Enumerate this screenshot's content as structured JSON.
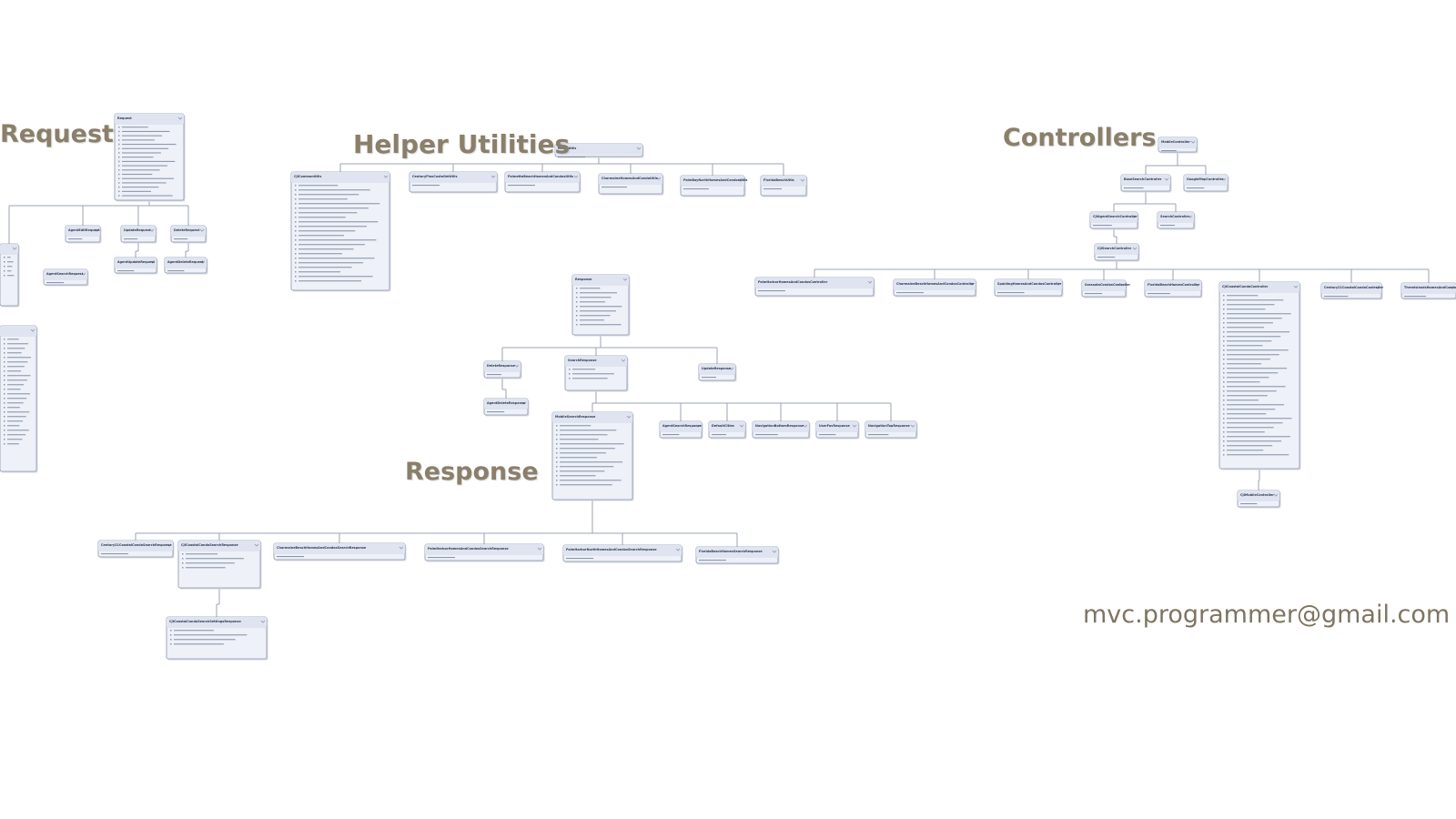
{
  "sections": {
    "request": "Request",
    "helper": "Helper Utilities",
    "controllers": "Controllers",
    "response": "Response"
  },
  "contact": {
    "email": "mvc.programmer@gmail.com"
  },
  "colors": {
    "box_fill": "#eef1f8",
    "box_header": "#dfe4f0",
    "box_border": "#8c96ad",
    "connector": "#9aa3b5",
    "title_text": "#8a7f6a",
    "member_text": "#8d97ab"
  },
  "classes": [
    {
      "id": "request",
      "name": "Request",
      "members": 17
    },
    {
      "id": "agent-edit-request",
      "name": "AgentEditRequest",
      "members": 0
    },
    {
      "id": "update-request",
      "name": "UpdateRequest",
      "members": 0
    },
    {
      "id": "delete-request",
      "name": "DeleteRequest",
      "members": 0
    },
    {
      "id": "agent-update-request",
      "name": "AgentUpdateRequest",
      "members": 0
    },
    {
      "id": "agent-delete-request",
      "name": "AgentDeleteRequest",
      "members": 0
    },
    {
      "id": "agent-search-request",
      "name": "AgentSearchRequest",
      "members": 0
    },
    {
      "id": "req-left-a",
      "name": "",
      "members": 5
    },
    {
      "id": "req-left-b",
      "name": "",
      "members": 24
    },
    {
      "id": "model-utils",
      "name": "ModelUtils",
      "members": 0
    },
    {
      "id": "cji-common-utils",
      "name": "CJICommonUtils",
      "members": 22
    },
    {
      "id": "helper-1",
      "name": "CenturyPlusCustoGetUtils",
      "members": 0
    },
    {
      "id": "helper-2",
      "name": "PalmettoBeachHomesAndCondosUtils",
      "members": 0
    },
    {
      "id": "helper-3",
      "name": "CharmaineHomesAndCondoUtils",
      "members": 0
    },
    {
      "id": "helper-4",
      "name": "PalmBayNorthHomesAndCondosUtils",
      "members": 0
    },
    {
      "id": "helper-5",
      "name": "FloridaBeachUtils",
      "members": 0
    },
    {
      "id": "mobile-controller",
      "name": "MobileController",
      "members": 0
    },
    {
      "id": "base-search-controller",
      "name": "BaseSearchController",
      "members": 0
    },
    {
      "id": "google-map-controller",
      "name": "GoogleMapController",
      "members": 0
    },
    {
      "id": "cji-agent-search-controller",
      "name": "CJIAgentSearchController",
      "members": 0
    },
    {
      "id": "search-controller",
      "name": "SearchController",
      "members": 0
    },
    {
      "id": "cji-search-controller",
      "name": "CJISearchController",
      "members": 0
    },
    {
      "id": "ctrl-1",
      "name": "PalmHarborHomesAndCondosController",
      "members": 0
    },
    {
      "id": "ctrl-2",
      "name": "CharmaineBeachHomesAndCondosController",
      "members": 0
    },
    {
      "id": "ctrl-3",
      "name": "SpaldingHomesAndCondosController",
      "members": 0
    },
    {
      "id": "ctrl-4",
      "name": "SarasotaCondosController",
      "members": 0
    },
    {
      "id": "ctrl-5",
      "name": "FloridaBeachHomesController",
      "members": 0
    },
    {
      "id": "cji-coastal-condo-controller",
      "name": "CJICoastalCondoController",
      "members": 36
    },
    {
      "id": "ctrl-7",
      "name": "Century21CoastalCondoController",
      "members": 0
    },
    {
      "id": "ctrl-8",
      "name": "ThreeIslandsHomesAndCondosController",
      "members": 0
    },
    {
      "id": "cji-mobile-controller",
      "name": "CJIMobileController",
      "members": 0
    },
    {
      "id": "response",
      "name": "Response",
      "members": 9
    },
    {
      "id": "delete-response",
      "name": "DeleteResponse",
      "members": 0
    },
    {
      "id": "search-response",
      "name": "SearchResponse",
      "members": 3
    },
    {
      "id": "update-response",
      "name": "UpdateResponse",
      "members": 0
    },
    {
      "id": "agent-delete-response",
      "name": "AgentDeleteResponse",
      "members": 0
    },
    {
      "id": "mobile-search-response",
      "name": "MobileSearchResponse",
      "members": 14
    },
    {
      "id": "agent-search-response",
      "name": "AgentSearchResponse",
      "members": 0
    },
    {
      "id": "default-cities",
      "name": "DefaultCities",
      "members": 0
    },
    {
      "id": "navigation-bottom-response",
      "name": "NavigationBottomResponse",
      "members": 0
    },
    {
      "id": "user-fav-response",
      "name": "UserFavResponse",
      "members": 0
    },
    {
      "id": "navigation-top-response",
      "name": "NavigationTopResponse",
      "members": 0
    },
    {
      "id": "resp-1",
      "name": "Century21CoastalCondoSearchResponse",
      "members": 0
    },
    {
      "id": "cji-coastal-condo-search-response",
      "name": "CJICoastalCondoSearchResponse",
      "members": 4
    },
    {
      "id": "resp-3",
      "name": "CharmaineBeachHomesAndCondosSearchResponse",
      "members": 0
    },
    {
      "id": "resp-4",
      "name": "PalmHarborHomesAndCondosSearchResponse",
      "members": 0
    },
    {
      "id": "resp-5",
      "name": "PalmHarborNorthHomesAndCondosSearchResponse",
      "members": 0
    },
    {
      "id": "resp-6",
      "name": "FloridaBeachHomesSearchResponse",
      "members": 0
    },
    {
      "id": "cji-coastal-condo-search-settings-response",
      "name": "CJICoastalCondoSearchSettingsResponse",
      "members": 4
    }
  ]
}
